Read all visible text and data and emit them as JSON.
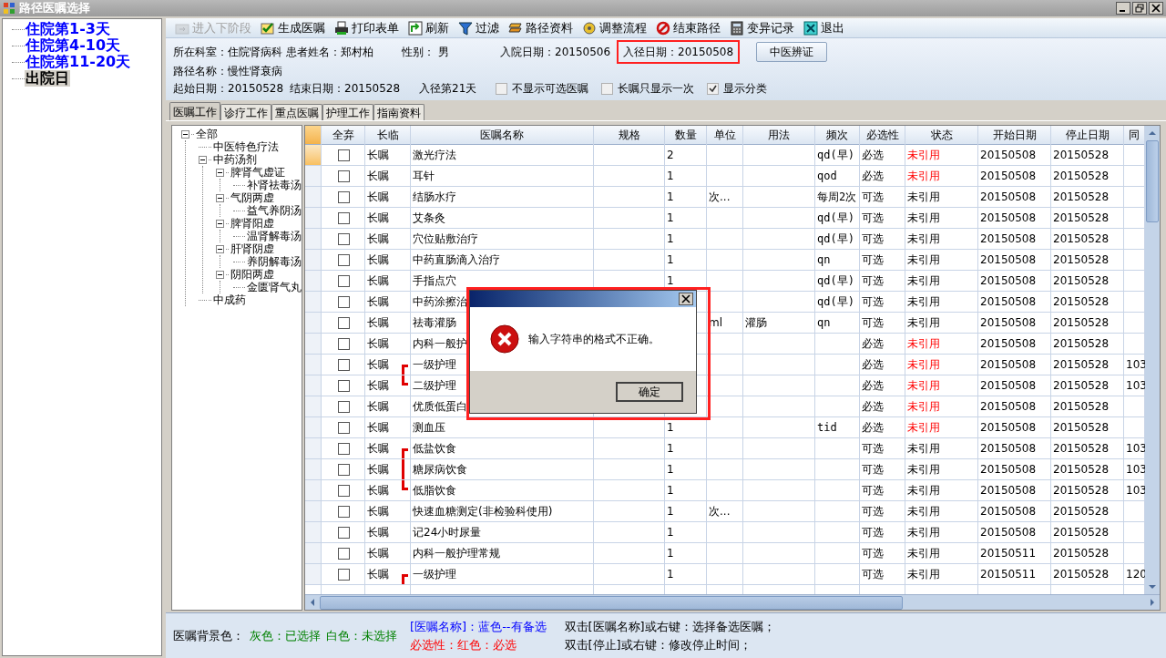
{
  "window": {
    "title": "路径医嘱选择"
  },
  "stages": [
    {
      "label": "住院第1-3天",
      "selected": false
    },
    {
      "label": "住院第4-10天",
      "selected": false
    },
    {
      "label": "住院第11-20天",
      "selected": false
    },
    {
      "label": "出院日",
      "selected": true
    }
  ],
  "toolbar": [
    {
      "label": "进入下阶段",
      "disabled": true
    },
    {
      "label": "生成医嘱",
      "disabled": false
    },
    {
      "label": "打印表单",
      "disabled": false
    },
    {
      "label": "刷新",
      "disabled": false
    },
    {
      "label": "过滤",
      "disabled": false
    },
    {
      "label": "路径资料",
      "disabled": false
    },
    {
      "label": "调整流程",
      "disabled": false
    },
    {
      "label": "结束路径",
      "disabled": false
    },
    {
      "label": "变异记录",
      "disabled": false
    },
    {
      "label": "退出",
      "disabled": false
    }
  ],
  "info": {
    "row1": [
      {
        "text": "所在科室：住院肾病科",
        "highlighted": false
      },
      {
        "text": "患者姓名：郑村柏",
        "highlighted": false
      },
      {
        "text": "性别： 男",
        "highlighted": false
      },
      {
        "text": "入院日期：20150506",
        "highlighted": false
      },
      {
        "text": "入径日期：20150508",
        "highlighted": true
      }
    ],
    "button": "中医辨证",
    "row2": "路径名称：慢性肾衰病",
    "row3": [
      "起始日期：20150528",
      "结束日期：20150528",
      "入径第21天"
    ],
    "options": [
      {
        "label": "不显示可选医嘱",
        "checked": false
      },
      {
        "label": "长嘱只显示一次",
        "checked": false
      },
      {
        "label": "显示分类",
        "checked": true
      }
    ]
  },
  "tabs": [
    {
      "label": "医嘱工作",
      "selected": true
    },
    {
      "label": "诊疗工作",
      "selected": false
    },
    {
      "label": "重点医嘱",
      "selected": false
    },
    {
      "label": "护理工作",
      "selected": false
    },
    {
      "label": "指南资料",
      "selected": false
    }
  ],
  "category_tree": [
    {
      "label": "全部",
      "expanded": true,
      "children": [
        {
          "label": "中医特色疗法"
        },
        {
          "label": "中药汤剂",
          "expanded": true,
          "children": [
            {
              "label": "脾肾气虚证",
              "expanded": true,
              "children": [
                {
                  "label": "补肾祛毒汤"
                }
              ]
            },
            {
              "label": "气阴两虚",
              "expanded": true,
              "children": [
                {
                  "label": "益气养阴汤"
                }
              ]
            },
            {
              "label": "脾肾阳虚",
              "expanded": true,
              "children": [
                {
                  "label": "温肾解毒汤"
                }
              ]
            },
            {
              "label": "肝肾阴虚",
              "expanded": true,
              "children": [
                {
                  "label": "养阴解毒汤"
                }
              ]
            },
            {
              "label": "阴阳两虚",
              "expanded": true,
              "children": [
                {
                  "label": "金匮肾气丸"
                }
              ]
            }
          ]
        },
        {
          "label": "中成药"
        }
      ]
    }
  ],
  "table": {
    "columns": [
      "全弃",
      "长临",
      "医嘱名称",
      "规格",
      "数量",
      "单位",
      "用法",
      "频次",
      "必选性",
      "状态",
      "开始日期",
      "停止日期",
      "同"
    ],
    "rows": [
      {
        "selected": true,
        "checked": false,
        "type": "长嘱",
        "name": "激光疗法",
        "qty": "2",
        "unit": "",
        "usage": "",
        "freq": "qd(早)",
        "necessity": "必选",
        "required": true,
        "status": "未引用",
        "start": "20150508",
        "stop": "20150528",
        "same": ""
      },
      {
        "selected": false,
        "checked": false,
        "type": "长嘱",
        "name": "耳针",
        "qty": "1",
        "unit": "",
        "usage": "",
        "freq": "qod",
        "necessity": "必选",
        "required": true,
        "status": "未引用",
        "start": "20150508",
        "stop": "20150528",
        "same": ""
      },
      {
        "selected": false,
        "checked": false,
        "type": "长嘱",
        "name": "结肠水疗",
        "qty": "1",
        "unit": "次...",
        "usage": "",
        "freq": "每周2次",
        "necessity": "可选",
        "required": false,
        "status": "未引用",
        "start": "20150508",
        "stop": "20150528",
        "same": ""
      },
      {
        "selected": false,
        "checked": false,
        "type": "长嘱",
        "name": "艾条灸",
        "qty": "1",
        "unit": "",
        "usage": "",
        "freq": "qd(早)",
        "necessity": "可选",
        "required": false,
        "status": "未引用",
        "start": "20150508",
        "stop": "20150528",
        "same": ""
      },
      {
        "selected": false,
        "checked": false,
        "type": "长嘱",
        "name": "穴位贴敷治疗",
        "qty": "1",
        "unit": "",
        "usage": "",
        "freq": "qd(早)",
        "necessity": "可选",
        "required": false,
        "status": "未引用",
        "start": "20150508",
        "stop": "20150528",
        "same": ""
      },
      {
        "selected": false,
        "checked": false,
        "type": "长嘱",
        "name": "中药直肠滴入治疗",
        "qty": "1",
        "unit": "",
        "usage": "",
        "freq": "qn",
        "necessity": "可选",
        "required": false,
        "status": "未引用",
        "start": "20150508",
        "stop": "20150528",
        "same": ""
      },
      {
        "selected": false,
        "checked": false,
        "type": "长嘱",
        "name": "手指点穴",
        "qty": "1",
        "unit": "",
        "usage": "",
        "freq": "qd(早)",
        "necessity": "可选",
        "required": false,
        "status": "未引用",
        "start": "20150508",
        "stop": "20150528",
        "same": ""
      },
      {
        "selected": false,
        "checked": false,
        "type": "长嘱",
        "name": "中药涂擦治",
        "qty": "",
        "unit": "",
        "usage": "",
        "freq": "qd(早)",
        "necessity": "可选",
        "required": false,
        "status": "未引用",
        "start": "20150508",
        "stop": "20150528",
        "same": ""
      },
      {
        "selected": false,
        "checked": false,
        "type": "长嘱",
        "name": "祛毒灌肠",
        "qty": "",
        "unit": "ml",
        "usage": "灌肠",
        "freq": "qn",
        "necessity": "可选",
        "required": false,
        "status": "未引用",
        "start": "20150508",
        "stop": "20150528",
        "same": ""
      },
      {
        "selected": false,
        "checked": false,
        "type": "长嘱",
        "name": "内科一般护",
        "qty": "",
        "unit": "",
        "usage": "",
        "freq": "",
        "necessity": "必选",
        "required": true,
        "status": "未引用",
        "start": "20150508",
        "stop": "20150528",
        "same": ""
      },
      {
        "selected": false,
        "checked": false,
        "type": "长嘱",
        "name": "一级护理",
        "kind": "bracket_start",
        "qty": "",
        "unit": "",
        "usage": "",
        "freq": "",
        "necessity": "必选",
        "required": true,
        "status": "未引用",
        "start": "20150508",
        "stop": "20150528",
        "same": "103"
      },
      {
        "selected": false,
        "checked": false,
        "type": "长嘱",
        "name": "二级护理",
        "kind": "bracket_end",
        "qty": "",
        "unit": "",
        "usage": "",
        "freq": "",
        "necessity": "必选",
        "required": true,
        "status": "未引用",
        "start": "20150508",
        "stop": "20150528",
        "same": "103"
      },
      {
        "selected": false,
        "checked": false,
        "type": "长嘱",
        "name": "优质低蛋白",
        "qty": "",
        "unit": "",
        "usage": "",
        "freq": "",
        "necessity": "必选",
        "required": true,
        "status": "未引用",
        "start": "20150508",
        "stop": "20150528",
        "same": ""
      },
      {
        "selected": false,
        "checked": false,
        "type": "长嘱",
        "name": "测血压",
        "qty": "1",
        "unit": "",
        "usage": "",
        "freq": "tid",
        "necessity": "必选",
        "required": true,
        "status": "未引用",
        "start": "20150508",
        "stop": "20150528",
        "same": ""
      },
      {
        "selected": false,
        "checked": false,
        "type": "长嘱",
        "name": "低盐饮食",
        "kind": "bracket_start",
        "qty": "1",
        "unit": "",
        "usage": "",
        "freq": "",
        "necessity": "可选",
        "required": false,
        "status": "未引用",
        "start": "20150508",
        "stop": "20150528",
        "same": "103"
      },
      {
        "selected": false,
        "checked": false,
        "type": "长嘱",
        "name": "糖尿病饮食",
        "kind": "bracket_mid",
        "qty": "1",
        "unit": "",
        "usage": "",
        "freq": "",
        "necessity": "可选",
        "required": false,
        "status": "未引用",
        "start": "20150508",
        "stop": "20150528",
        "same": "103"
      },
      {
        "selected": false,
        "checked": false,
        "type": "长嘱",
        "name": "低脂饮食",
        "kind": "bracket_end",
        "qty": "1",
        "unit": "",
        "usage": "",
        "freq": "",
        "necessity": "可选",
        "required": false,
        "status": "未引用",
        "start": "20150508",
        "stop": "20150528",
        "same": "103"
      },
      {
        "selected": false,
        "checked": false,
        "type": "长嘱",
        "name": "快速血糖测定(非检验科使用)",
        "qty": "1",
        "unit": "次...",
        "usage": "",
        "freq": "",
        "necessity": "可选",
        "required": false,
        "status": "未引用",
        "start": "20150508",
        "stop": "20150528",
        "same": ""
      },
      {
        "selected": false,
        "checked": false,
        "type": "长嘱",
        "name": "记24小时尿量",
        "qty": "1",
        "unit": "",
        "usage": "",
        "freq": "",
        "necessity": "可选",
        "required": false,
        "status": "未引用",
        "start": "20150508",
        "stop": "20150528",
        "same": ""
      },
      {
        "selected": false,
        "checked": false,
        "type": "长嘱",
        "name": "内科一般护理常规",
        "qty": "1",
        "unit": "",
        "usage": "",
        "freq": "",
        "necessity": "可选",
        "required": false,
        "status": "未引用",
        "start": "20150511",
        "stop": "20150528",
        "same": ""
      },
      {
        "selected": false,
        "checked": false,
        "type": "长嘱",
        "name": "一级护理",
        "kind": "bracket_start",
        "qty": "1",
        "unit": "",
        "usage": "",
        "freq": "",
        "necessity": "可选",
        "required": false,
        "status": "未引用",
        "start": "20150511",
        "stop": "20150528",
        "same": "120"
      }
    ]
  },
  "dialog": {
    "message": "输入字符串的格式不正确。",
    "button": "确定",
    "highlighted": true
  },
  "footer": {
    "legend": [
      {
        "text": "医嘱背景色："
      },
      {
        "text": "灰色：已选择",
        "color": "#008000"
      },
      {
        "text": "白色：未选择",
        "color": "#008000"
      },
      {
        "text": "[医嘱名称]：蓝色--有备选",
        "color": "#0000ff"
      },
      {
        "text": "必选性：红色：必选",
        "color": "#ff0000"
      }
    ],
    "hints": [
      "双击[医嘱名称]或右键：选择备选医嘱；",
      "双击[停止]或右键：修改停止时间；"
    ]
  }
}
